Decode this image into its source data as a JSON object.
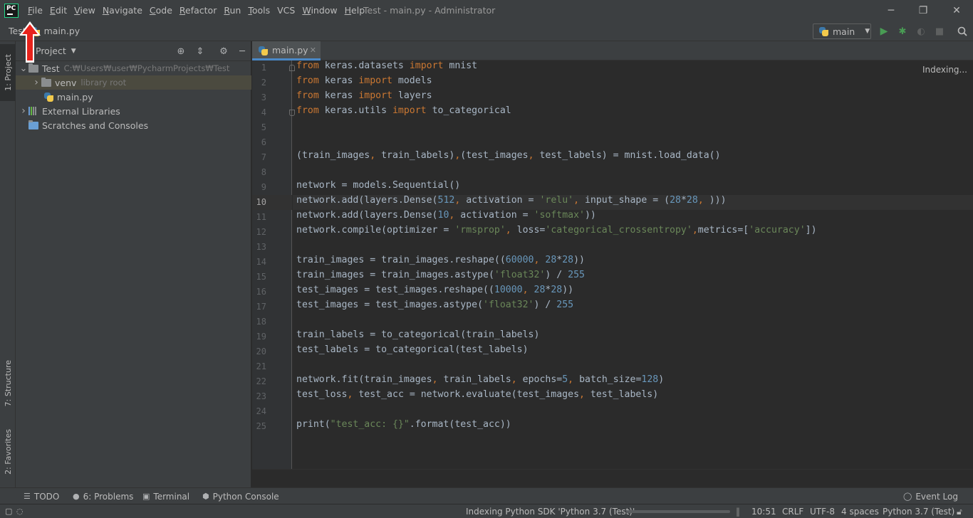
{
  "window": {
    "title": "Test - main.py - Administrator",
    "logo_text": "PC",
    "minimize": "─",
    "restore": "❐",
    "close": "✕"
  },
  "menu": [
    {
      "label": "File",
      "mnemonic": "F",
      "rest": "ile"
    },
    {
      "label": "Edit",
      "mnemonic": "E",
      "rest": "dit"
    },
    {
      "label": "View",
      "mnemonic": "V",
      "rest": "iew"
    },
    {
      "label": "Navigate",
      "mnemonic": "N",
      "rest": "avigate"
    },
    {
      "label": "Code",
      "mnemonic": "C",
      "rest": "ode"
    },
    {
      "label": "Refactor",
      "mnemonic": "R",
      "rest": "efactor"
    },
    {
      "label": "Run",
      "mnemonic": "R",
      "rest": "un"
    },
    {
      "label": "Tools",
      "mnemonic": "T",
      "rest": "ools"
    },
    {
      "label": "VCS",
      "mnemonic": "",
      "rest": "VCS"
    },
    {
      "label": "Window",
      "mnemonic": "W",
      "rest": "indow"
    },
    {
      "label": "Help",
      "mnemonic": "H",
      "rest": "elp"
    }
  ],
  "navbar": {
    "project": "Test",
    "file": "main.py",
    "run_config": "main"
  },
  "left_stripe": {
    "project_tab": "1: Project",
    "structure_tab": "7: Structure",
    "favorites_tab": "2: Favorites"
  },
  "project_panel": {
    "title": "Project",
    "tree": [
      {
        "label": "Test",
        "hint": "C:₩Users₩user₩PycharmProjects₩Test",
        "type": "folder",
        "expanded": true
      },
      {
        "label": "venv",
        "hint": "library root",
        "type": "folder",
        "expanded": false
      },
      {
        "label": "main.py",
        "hint": "",
        "type": "python"
      },
      {
        "label": "External Libraries",
        "hint": "",
        "type": "library",
        "expanded": false
      },
      {
        "label": "Scratches and Consoles",
        "hint": "",
        "type": "scratch"
      }
    ]
  },
  "editor": {
    "tab": "main.py",
    "status": "Indexing...",
    "current_line": 10,
    "line_count": 25,
    "lines": [
      [
        [
          "k",
          "from"
        ],
        [
          "p",
          " keras.datasets "
        ],
        [
          "k",
          "import"
        ],
        [
          "p",
          " mnist"
        ]
      ],
      [
        [
          "k",
          "from"
        ],
        [
          "p",
          " keras "
        ],
        [
          "k",
          "import"
        ],
        [
          "p",
          " models"
        ]
      ],
      [
        [
          "k",
          "from"
        ],
        [
          "p",
          " keras "
        ],
        [
          "k",
          "import"
        ],
        [
          "p",
          " layers"
        ]
      ],
      [
        [
          "k",
          "from"
        ],
        [
          "p",
          " keras.utils "
        ],
        [
          "k",
          "import"
        ],
        [
          "p",
          " to_categorical"
        ]
      ],
      [],
      [],
      [
        [
          "p",
          "(train_images"
        ],
        [
          "k",
          ","
        ],
        [
          "p",
          " train_labels)"
        ],
        [
          "k",
          ","
        ],
        [
          "p",
          "(test_images"
        ],
        [
          "k",
          ","
        ],
        [
          "p",
          " test_labels) = mnist.load_data()"
        ]
      ],
      [],
      [
        [
          "p",
          "network = models.Sequential()"
        ]
      ],
      [
        [
          "p",
          "network.add(layers.Dense("
        ],
        [
          "n",
          "512"
        ],
        [
          "k",
          ","
        ],
        [
          "p",
          " activation = "
        ],
        [
          "s",
          "'relu'"
        ],
        [
          "k",
          ","
        ],
        [
          "p",
          " input_shape = ("
        ],
        [
          "n",
          "28"
        ],
        [
          "p",
          "*"
        ],
        [
          "n",
          "28"
        ],
        [
          "k",
          ","
        ],
        [
          "p",
          " )))"
        ]
      ],
      [
        [
          "p",
          "network.add(layers.Dense("
        ],
        [
          "n",
          "10"
        ],
        [
          "k",
          ","
        ],
        [
          "p",
          " activation = "
        ],
        [
          "s",
          "'softmax'"
        ],
        [
          "p",
          "))"
        ]
      ],
      [
        [
          "p",
          "network.compile(optimizer = "
        ],
        [
          "s",
          "'rmsprop'"
        ],
        [
          "k",
          ","
        ],
        [
          "p",
          " loss="
        ],
        [
          "s",
          "'categorical_crossentropy'"
        ],
        [
          "k",
          ","
        ],
        [
          "p",
          "metrics=["
        ],
        [
          "s",
          "'accuracy'"
        ],
        [
          "p",
          "])"
        ]
      ],
      [],
      [
        [
          "p",
          "train_images = train_images.reshape(("
        ],
        [
          "n",
          "60000"
        ],
        [
          "k",
          ","
        ],
        [
          "p",
          " "
        ],
        [
          "n",
          "28"
        ],
        [
          "p",
          "*"
        ],
        [
          "n",
          "28"
        ],
        [
          "p",
          "))"
        ]
      ],
      [
        [
          "p",
          "train_images = train_images.astype("
        ],
        [
          "s",
          "'float32'"
        ],
        [
          "p",
          ") / "
        ],
        [
          "n",
          "255"
        ]
      ],
      [
        [
          "p",
          "test_images = test_images.reshape(("
        ],
        [
          "n",
          "10000"
        ],
        [
          "k",
          ","
        ],
        [
          "p",
          " "
        ],
        [
          "n",
          "28"
        ],
        [
          "p",
          "*"
        ],
        [
          "n",
          "28"
        ],
        [
          "p",
          "))"
        ]
      ],
      [
        [
          "p",
          "test_images = test_images.astype("
        ],
        [
          "s",
          "'float32'"
        ],
        [
          "p",
          ") / "
        ],
        [
          "n",
          "255"
        ]
      ],
      [],
      [
        [
          "p",
          "train_labels = to_categorical(train_labels)"
        ]
      ],
      [
        [
          "p",
          "test_labels = to_categorical(test_labels)"
        ]
      ],
      [],
      [
        [
          "p",
          "network.fit(train_images"
        ],
        [
          "k",
          ","
        ],
        [
          "p",
          " train_labels"
        ],
        [
          "k",
          ","
        ],
        [
          "p",
          " epochs="
        ],
        [
          "n",
          "5"
        ],
        [
          "k",
          ","
        ],
        [
          "p",
          " batch_size="
        ],
        [
          "n",
          "128"
        ],
        [
          "p",
          ")"
        ]
      ],
      [
        [
          "p",
          "test_loss"
        ],
        [
          "k",
          ","
        ],
        [
          "p",
          " test_acc = network.evaluate(test_images"
        ],
        [
          "k",
          ","
        ],
        [
          "p",
          " test_labels)"
        ]
      ],
      [],
      [
        [
          "p",
          "print("
        ],
        [
          "s",
          "\"test_acc: {}\""
        ],
        [
          "p",
          ".format(test_acc))"
        ]
      ]
    ]
  },
  "bottom_tools": [
    {
      "label": "TODO",
      "icon": "☰"
    },
    {
      "label": "6: Problems",
      "icon": "●"
    },
    {
      "label": "Terminal",
      "icon": "▣"
    },
    {
      "label": "Python Console",
      "icon": "⬢"
    }
  ],
  "event_log": "Event Log",
  "status_bar": {
    "indexing_text": "Indexing Python SDK 'Python 3.7 (Test)'",
    "indexing_progress": 0.0,
    "position": "10:51",
    "line_sep": "CRLF",
    "encoding": "UTF-8",
    "indent": "4 spaces",
    "interpreter": "Python 3.7 (Test)"
  },
  "colors": {
    "annotation_arrow": "#e8231c",
    "keyword": "#cc7832",
    "string": "#6a8759",
    "number": "#6897bb",
    "run": "#499c54"
  }
}
